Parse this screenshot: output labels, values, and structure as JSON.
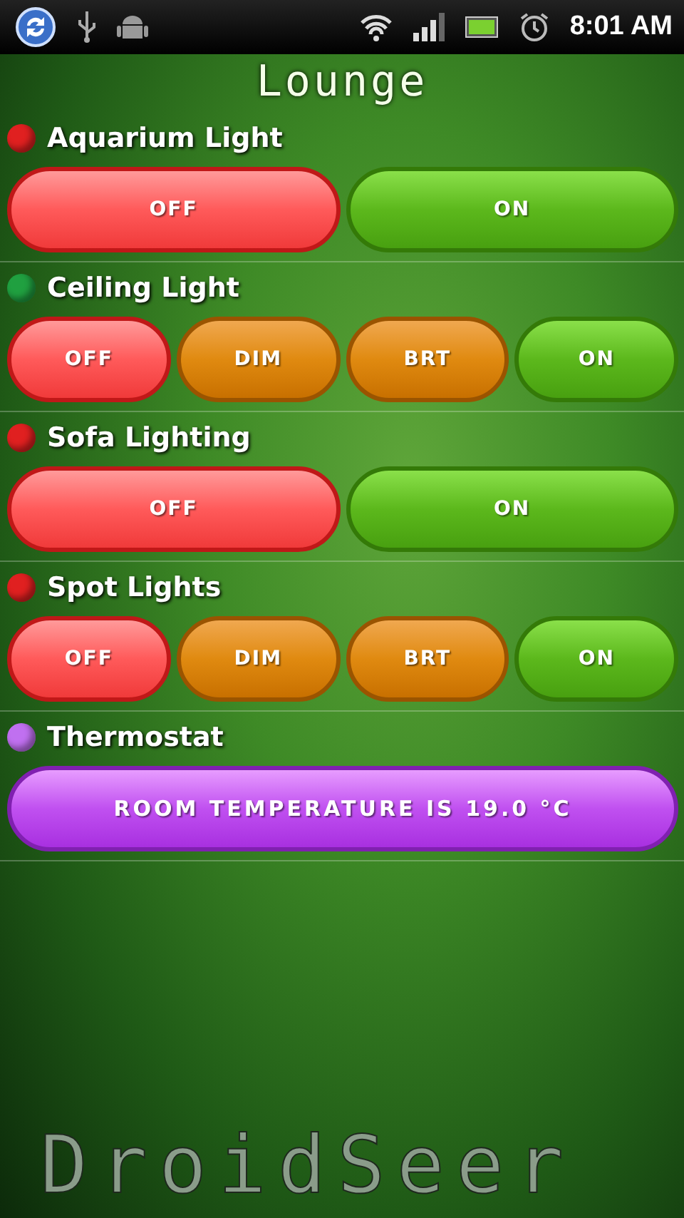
{
  "status_bar": {
    "time": "8:01 AM"
  },
  "title": "Lounge",
  "devices": [
    {
      "name": "Aquarium Light",
      "color": "#e02020",
      "buttons": [
        {
          "label": "OFF",
          "kind": "off"
        },
        {
          "label": "ON",
          "kind": "on"
        }
      ]
    },
    {
      "name": "Ceiling Light",
      "color": "#20a040",
      "buttons": [
        {
          "label": "OFF",
          "kind": "off"
        },
        {
          "label": "DIM",
          "kind": "dim"
        },
        {
          "label": "BRT",
          "kind": "brt"
        },
        {
          "label": "ON",
          "kind": "on"
        }
      ]
    },
    {
      "name": "Sofa Lighting",
      "color": "#e02020",
      "buttons": [
        {
          "label": "OFF",
          "kind": "off"
        },
        {
          "label": "ON",
          "kind": "on"
        }
      ]
    },
    {
      "name": "Spot Lights",
      "color": "#e02020",
      "buttons": [
        {
          "label": "OFF",
          "kind": "off"
        },
        {
          "label": "DIM",
          "kind": "dim"
        },
        {
          "label": "BRT",
          "kind": "brt"
        },
        {
          "label": "ON",
          "kind": "on"
        }
      ]
    },
    {
      "name": "Thermostat",
      "color": "#c070f0",
      "buttons": [
        {
          "label": "ROOM TEMPERATURE IS 19.0 °C",
          "kind": "info"
        }
      ]
    }
  ],
  "logo": "DroidSeer"
}
